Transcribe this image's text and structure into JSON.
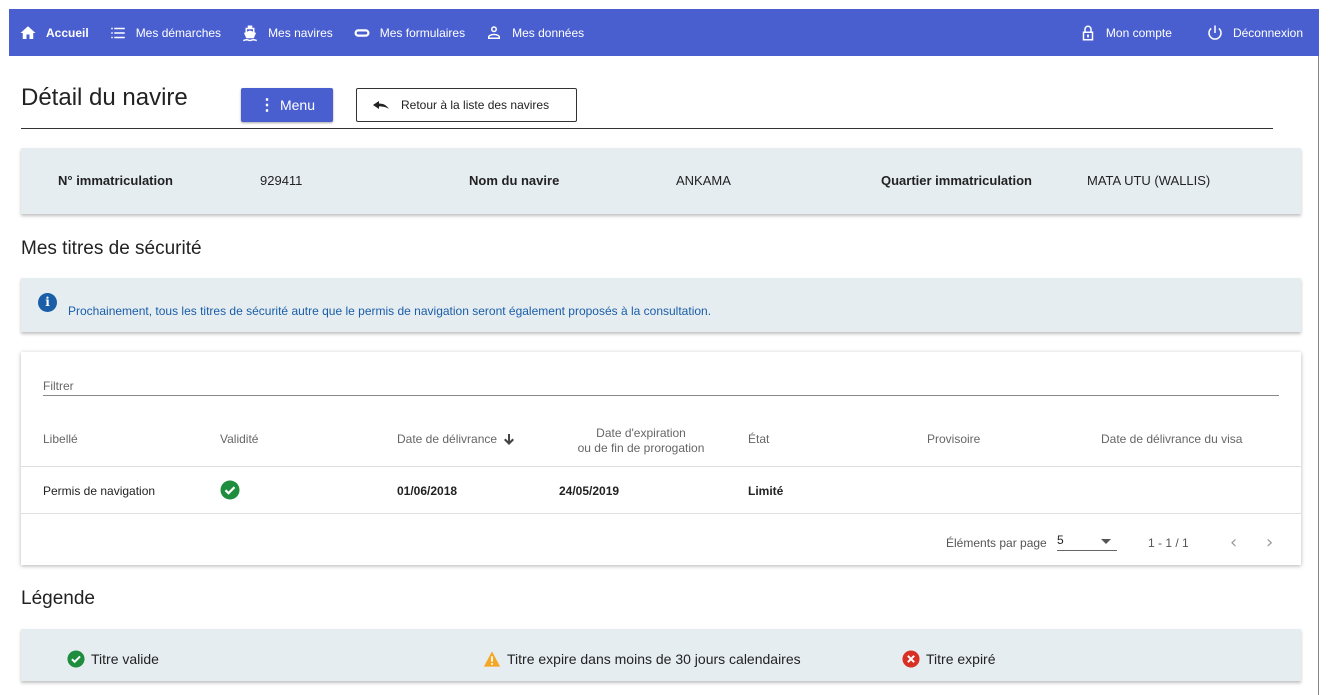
{
  "nav": {
    "items": [
      {
        "label": "Accueil",
        "icon": "home-icon"
      },
      {
        "label": "Mes démarches",
        "icon": "list-icon"
      },
      {
        "label": "Mes navires",
        "icon": "ship-icon"
      },
      {
        "label": "Mes formulaires",
        "icon": "tag-icon"
      },
      {
        "label": "Mes données",
        "icon": "user-icon"
      }
    ],
    "account_label": "Mon compte",
    "logout_label": "Déconnexion",
    "color": "#4a5fcf"
  },
  "header": {
    "title": "Détail du navire",
    "menu_label": "Menu",
    "back_label": "Retour à la liste des navires"
  },
  "ship": {
    "reg_label": "N° immatriculation",
    "reg_value": "929411",
    "name_label": "Nom du navire",
    "name_value": "ANKAMA",
    "district_label": "Quartier immatriculation",
    "district_value": "MATA UTU (WALLIS)"
  },
  "security": {
    "title": "Mes titres de sécurité",
    "info_text": "Prochainement, tous les titres de sécurité autre que le permis de navigation seront également proposés à la consultation."
  },
  "table": {
    "filter_placeholder": "Filtrer",
    "columns": {
      "label": "Libellé",
      "validity": "Validité",
      "issue_date": "Date de délivrance",
      "expiry_line1": "Date d'expiration",
      "expiry_line2": "ou de fin de prorogation",
      "state": "État",
      "provisional": "Provisoire",
      "visa_date": "Date de délivrance du visa"
    },
    "rows": [
      {
        "label": "Permis de navigation",
        "validity": "valid",
        "issue_date": "01/06/2018",
        "expiry_date": "24/05/2019",
        "state": "Limité",
        "provisional": "",
        "visa_date": ""
      }
    ],
    "pager": {
      "per_page_label": "Éléments par page",
      "per_page_value": "5",
      "range": "1 - 1 / 1"
    }
  },
  "legend": {
    "title": "Légende",
    "valid": "Titre valide",
    "warning": "Titre expire dans moins de 30 jours calendaires",
    "expired": "Titre expiré",
    "colors": {
      "valid": "#1e8e3e",
      "warning": "#f5a623",
      "expired": "#d93025"
    }
  }
}
